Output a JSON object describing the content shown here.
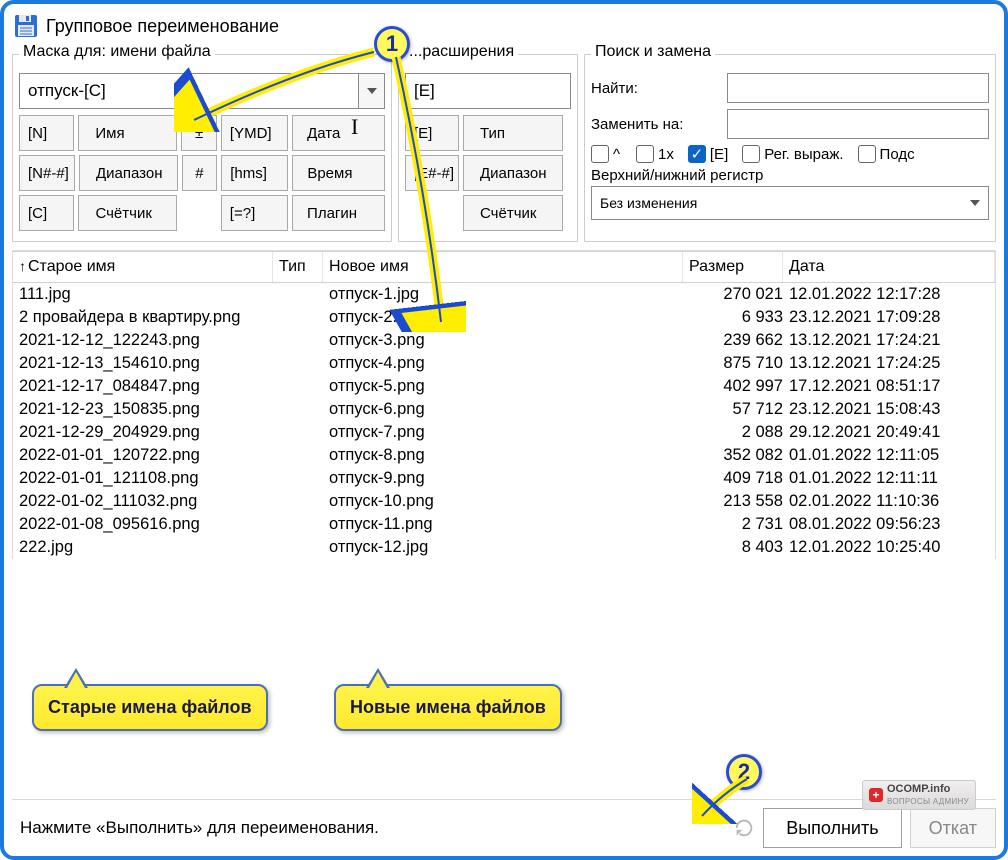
{
  "window": {
    "title": "Групповое переименование"
  },
  "mask": {
    "legend": "Маска для: имени файла",
    "value": "отпуск-[C]",
    "btn_n": "[N]",
    "btn_name": "Имя",
    "btn_nrange": "[N#-#]",
    "btn_range": "Диапазон",
    "btn_c": "[C]",
    "btn_counter": "Счётчик",
    "btn_plus": "±",
    "btn_hash": "#",
    "btn_ymd": "[YMD]",
    "btn_date": "Дата",
    "btn_hms": "[hms]",
    "btn_time": "Время",
    "btn_eq": "[=?]",
    "btn_plugin": "Плагин"
  },
  "ext": {
    "legend": "...расширения",
    "value": "[E]",
    "btn_e": "[E]",
    "btn_type": "Тип",
    "btn_erange": "[E#-#]",
    "btn_range": "Диапазон",
    "btn_counter": "Счётчик"
  },
  "sr": {
    "legend": "Поиск и замена",
    "find_label": "Найти:",
    "replace_label": "Заменить на:",
    "chk_caret": "^",
    "chk_once": "1x",
    "chk_e": "[E]",
    "chk_regex": "Рег. выраж.",
    "chk_sub": "Подс",
    "case_label": "Верхний/нижний регистр",
    "case_value": "Без изменения"
  },
  "table": {
    "col_old": "Старое имя",
    "col_type": "Тип",
    "col_new": "Новое имя",
    "col_size": "Размер",
    "col_date": "Дата",
    "rows": [
      {
        "old": "111.jpg",
        "new": "отпуск-1.jpg",
        "size": "270 021",
        "date": "12.01.2022 12:17:28"
      },
      {
        "old": "2 провайдера в квартиру.png",
        "new": "отпуск-2.png",
        "size": "6 933",
        "date": "23.12.2021 17:09:28"
      },
      {
        "old": "2021-12-12_122243.png",
        "new": "отпуск-3.png",
        "size": "239 662",
        "date": "13.12.2021 17:24:21"
      },
      {
        "old": "2021-12-13_154610.png",
        "new": "отпуск-4.png",
        "size": "875 710",
        "date": "13.12.2021 17:24:25"
      },
      {
        "old": "2021-12-17_084847.png",
        "new": "отпуск-5.png",
        "size": "402 997",
        "date": "17.12.2021 08:51:17"
      },
      {
        "old": "2021-12-23_150835.png",
        "new": "отпуск-6.png",
        "size": "57 712",
        "date": "23.12.2021 15:08:43"
      },
      {
        "old": "2021-12-29_204929.png",
        "new": "отпуск-7.png",
        "size": "2 088",
        "date": "29.12.2021 20:49:41"
      },
      {
        "old": "2022-01-01_120722.png",
        "new": "отпуск-8.png",
        "size": "352 082",
        "date": "01.01.2022 12:11:05"
      },
      {
        "old": "2022-01-01_121108.png",
        "new": "отпуск-9.png",
        "size": "409 718",
        "date": "01.01.2022 12:11:11"
      },
      {
        "old": "2022-01-02_111032.png",
        "new": "отпуск-10.png",
        "size": "213 558",
        "date": "02.01.2022 11:10:36"
      },
      {
        "old": "2022-01-08_095616.png",
        "new": "отпуск-11.png",
        "size": "2 731",
        "date": "08.01.2022 09:56:23"
      },
      {
        "old": "222.jpg",
        "new": "отпуск-12.jpg",
        "size": "8 403",
        "date": "12.01.2022 10:25:40"
      }
    ]
  },
  "footer": {
    "status": "Нажмите «Выполнить» для переименования.",
    "execute": "Выполнить",
    "rollback": "Откат"
  },
  "anno": {
    "badge1": "1",
    "badge2": "2",
    "bubble_old": "Старые имена файлов",
    "bubble_new": "Новые имена файлов"
  },
  "watermark": {
    "main": "OCOMP.info",
    "sub": "ВОПРОСЫ АДМИНУ"
  }
}
